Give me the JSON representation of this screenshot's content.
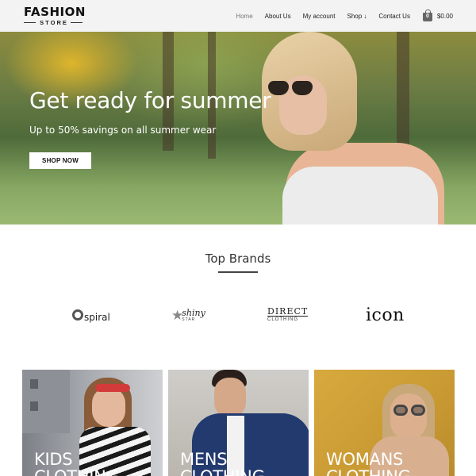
{
  "logo": {
    "top": "FASHION",
    "bottom": "STORE"
  },
  "nav": {
    "items": [
      {
        "label": "Home",
        "active": true
      },
      {
        "label": "About Us",
        "active": false
      },
      {
        "label": "My account",
        "active": false
      },
      {
        "label": "Shop ↓",
        "active": false
      },
      {
        "label": "Contact Us",
        "active": false
      }
    ],
    "cart": {
      "count": "0",
      "total": "$0.00",
      "icon": "shopping-bag-icon"
    }
  },
  "hero": {
    "title": "Get ready for summer",
    "subtitle": "Up to 50% savings on all summer wear",
    "button": "SHOP NOW"
  },
  "brands": {
    "title": "Top Brands",
    "items": [
      {
        "name": "spiral"
      },
      {
        "name": "shiny",
        "sub": "STAR"
      },
      {
        "name": "DIRECT",
        "sub": "CLOTHING"
      },
      {
        "name": "icon"
      }
    ]
  },
  "categories": [
    {
      "line1": "KIDS",
      "line2": "CLOTHING"
    },
    {
      "line1": "MENS",
      "line2": "CLOTHING"
    },
    {
      "line1": "WOMANS",
      "line2": "CLOTHING"
    }
  ],
  "colors": {
    "header_bg": "#f3f3f3",
    "text_dark": "#222222",
    "accent_white": "#ffffff"
  }
}
